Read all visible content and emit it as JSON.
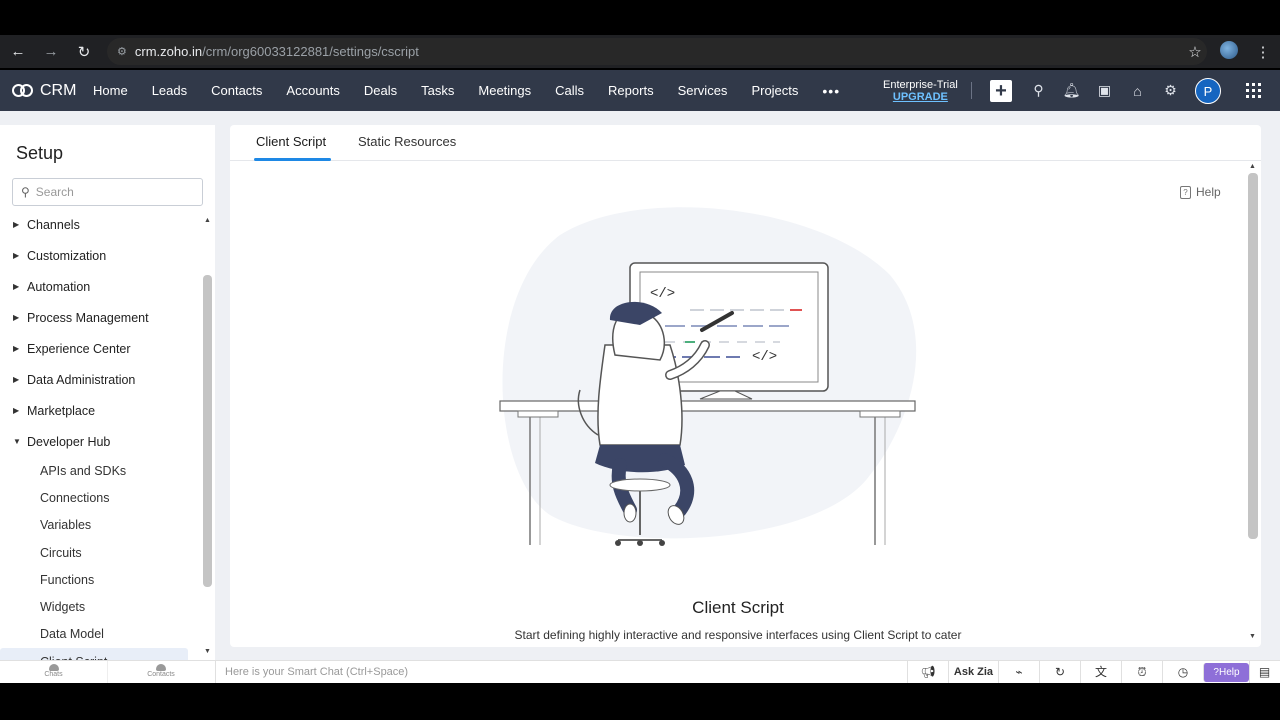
{
  "browser": {
    "url_host": "crm.zoho.in",
    "url_path": "/crm/org60033122881/settings/cscript"
  },
  "crm": {
    "brand": "CRM",
    "tabs": [
      "Home",
      "Leads",
      "Contacts",
      "Accounts",
      "Deals",
      "Tasks",
      "Meetings",
      "Calls",
      "Reports",
      "Services",
      "Projects"
    ],
    "more": "•••",
    "plan": "Enterprise-Trial",
    "upgrade": "UPGRADE",
    "avatar_initial": "P"
  },
  "sidebar": {
    "title": "Setup",
    "search_placeholder": "Search",
    "items": [
      {
        "label": "Channels",
        "expanded": false
      },
      {
        "label": "Customization",
        "expanded": false
      },
      {
        "label": "Automation",
        "expanded": false
      },
      {
        "label": "Process Management",
        "expanded": false
      },
      {
        "label": "Experience Center",
        "expanded": false
      },
      {
        "label": "Data Administration",
        "expanded": false
      },
      {
        "label": "Marketplace",
        "expanded": false
      },
      {
        "label": "Developer Hub",
        "expanded": true
      }
    ],
    "subitems": [
      "APIs and SDKs",
      "Connections",
      "Variables",
      "Circuits",
      "Functions",
      "Widgets",
      "Data Model",
      "Client Script"
    ],
    "active_subitem": "Client Script"
  },
  "main": {
    "tabs": [
      "Client Script",
      "Static Resources"
    ],
    "active_tab": "Client Script",
    "help": "Help",
    "empty_title": "Client Script",
    "empty_desc": "Start defining highly interactive and responsive interfaces using Client Script to cater",
    "code_tag": "</>"
  },
  "bottombar": {
    "chats": "Chats",
    "contacts": "Contacts",
    "smartchat_placeholder": "Here is your Smart Chat (Ctrl+Space)",
    "ask_zia": "Ask Zia",
    "help": "Help"
  },
  "colors": {
    "nav_bg": "#313949",
    "accent": "#1e88e5",
    "upgrade": "#6ec1ff",
    "help_button": "#8e6fd8"
  }
}
